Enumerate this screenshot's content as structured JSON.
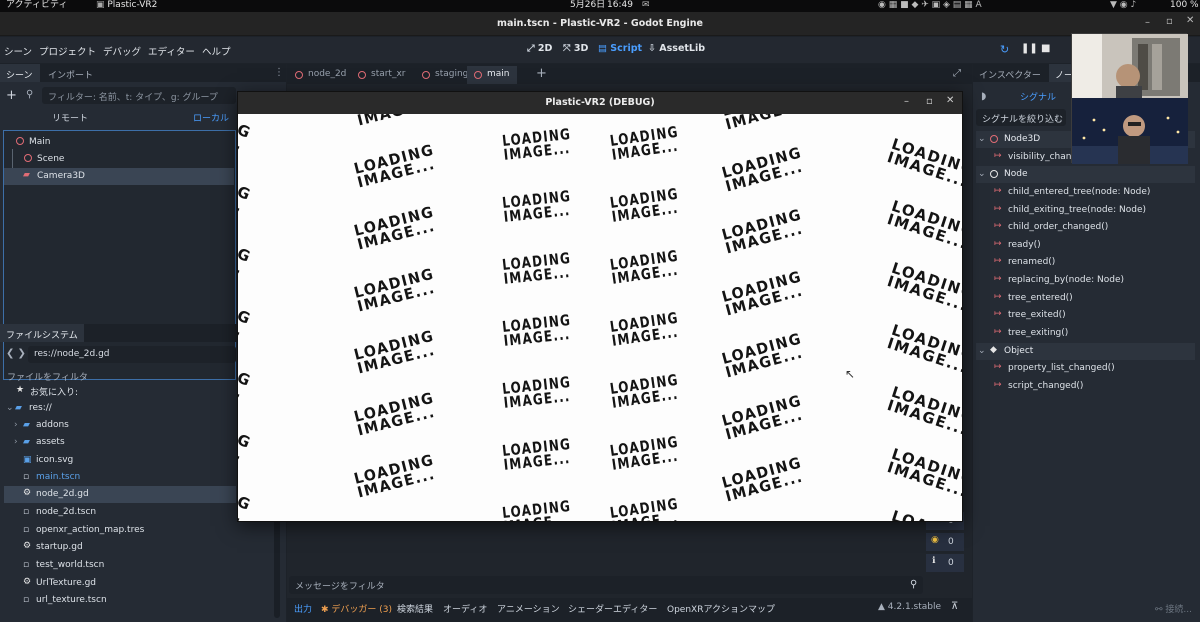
{
  "system_bar": {
    "activities": "アクティビティ",
    "app_name": "Plastic-VR2",
    "date": "5月26日",
    "time": "16:49",
    "battery": "100 %"
  },
  "window": {
    "title": "main.tscn - Plastic-VR2 - Godot Engine"
  },
  "menu": [
    "シーン",
    "プロジェクト",
    "デバッグ",
    "エディター",
    "ヘルプ"
  ],
  "workspaces": [
    "2D",
    "3D",
    "Script",
    "AssetLib"
  ],
  "scene_dock": {
    "tabs": [
      "シーン",
      "インポート"
    ],
    "filter_placeholder": "フィルター: 名前、t: タイプ、g: グループ",
    "remote": "リモート",
    "local": "ローカル",
    "tree": [
      "Main",
      "Scene",
      "Camera3D"
    ]
  },
  "filesystem": {
    "tab": "ファイルシステム",
    "path": "res://node_2d.gd",
    "filter_placeholder": "ファイルをフィルタ",
    "favorites": "お気に入り:",
    "items": [
      "res://",
      "addons",
      "assets",
      "icon.svg",
      "main.tscn",
      "node_2d.gd",
      "node_2d.tscn",
      "openxr_action_map.tres",
      "startup.gd",
      "test_world.tscn",
      "UrlTexture.gd",
      "url_texture.tscn"
    ]
  },
  "editor_tabs": [
    "node_2d",
    "start_xr",
    "staging",
    "main"
  ],
  "debug_window": {
    "title": "Plastic-VR2 (DEBUG)",
    "loading_text": "LOADING\nIMAGE..."
  },
  "bottom_panel": {
    "filter_placeholder": "メッセージをフィルタ",
    "tabs": [
      "出力",
      "デバッガー (3)",
      "検索結果",
      "オーディオ",
      "アニメーション",
      "シェーダーエディター",
      "OpenXRアクションマップ"
    ],
    "version": "4.2.1.stable",
    "counters": [
      "0",
      "0",
      "0"
    ]
  },
  "inspector": {
    "tabs": [
      "インスペクター",
      "ノード"
    ],
    "subtab": "シグナル",
    "filter_placeholder": "シグナルを絞り込む",
    "sections": [
      {
        "name": "Node3D",
        "signals": [
          "visibility_changed()"
        ]
      },
      {
        "name": "Node",
        "signals": [
          "child_entered_tree(node: Node)",
          "child_exiting_tree(node: Node)",
          "child_order_changed()",
          "ready()",
          "renamed()",
          "replacing_by(node: Node)",
          "tree_entered()",
          "tree_exited()",
          "tree_exiting()"
        ]
      },
      {
        "name": "Object",
        "signals": [
          "property_list_changed()",
          "script_changed()"
        ]
      }
    ],
    "connect_button": "接続..."
  },
  "colors": {
    "accent": "#4a9eff",
    "bg": "#1d2229",
    "signal_icon": "#e06c75"
  }
}
